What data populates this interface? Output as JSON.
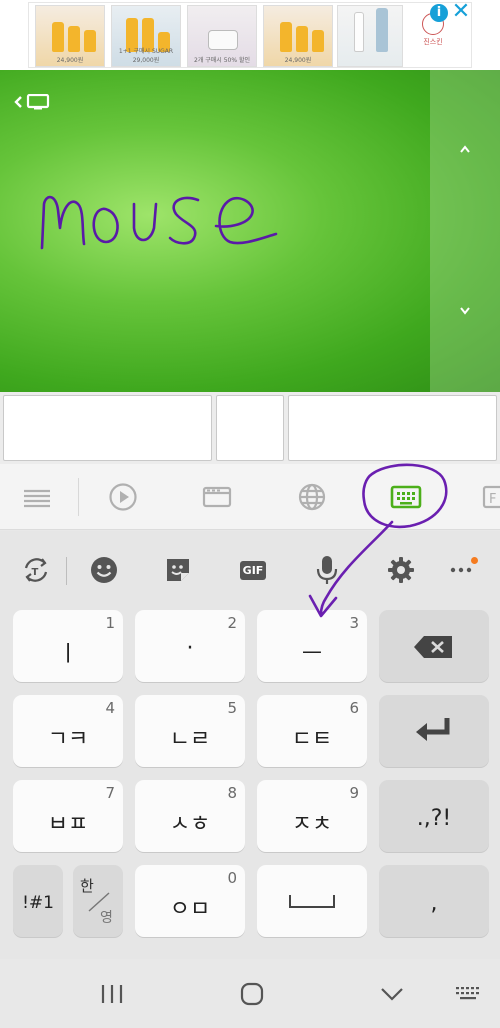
{
  "ad": {
    "thumbs": [
      {
        "caption": "24,900원"
      },
      {
        "caption": "1+1 구매시 SUGAR 29,000원"
      },
      {
        "caption": "2개 구매시 50% 할인"
      },
      {
        "caption": "24,900원"
      },
      {
        "caption": ""
      }
    ],
    "brand": "진스킨",
    "info_icon": "i",
    "close_icon": "✕"
  },
  "remote": {
    "handwriting_text": "mouse"
  },
  "keyboard": {
    "rows": [
      [
        {
          "label": "ㅣ",
          "num": "1"
        },
        {
          "label": "·",
          "num": "2"
        },
        {
          "label": "ㅡ",
          "num": "3"
        },
        {
          "label": "",
          "num": "",
          "icon": "backspace-icon"
        }
      ],
      [
        {
          "label": "ㄱㅋ",
          "num": "4"
        },
        {
          "label": "ㄴㄹ",
          "num": "5"
        },
        {
          "label": "ㄷㅌ",
          "num": "6"
        },
        {
          "label": "",
          "num": "",
          "icon": "enter-icon"
        }
      ],
      [
        {
          "label": "ㅂㅍ",
          "num": "7"
        },
        {
          "label": "ㅅㅎ",
          "num": "8"
        },
        {
          "label": "ㅈㅊ",
          "num": "9"
        },
        {
          "label": ".,?!",
          "num": ""
        }
      ],
      [
        {
          "label": "!#1",
          "num": ""
        },
        {
          "label": "한",
          "num": "",
          "sub": "영"
        },
        {
          "label": "ㅇㅁ",
          "num": "0"
        },
        {
          "label": "",
          "num": "",
          "icon": "space-icon"
        },
        {
          "label": ",",
          "num": ""
        }
      ]
    ],
    "tools": [
      "text-recognition-icon",
      "emoji-icon",
      "sticker-icon",
      "GIF",
      "microphone-icon",
      "settings-icon",
      "more-icon"
    ]
  },
  "colors": {
    "accent_green": "#4caf1a",
    "annotation_purple": "#6a1fb0",
    "alert_orange": "#f57c20"
  }
}
